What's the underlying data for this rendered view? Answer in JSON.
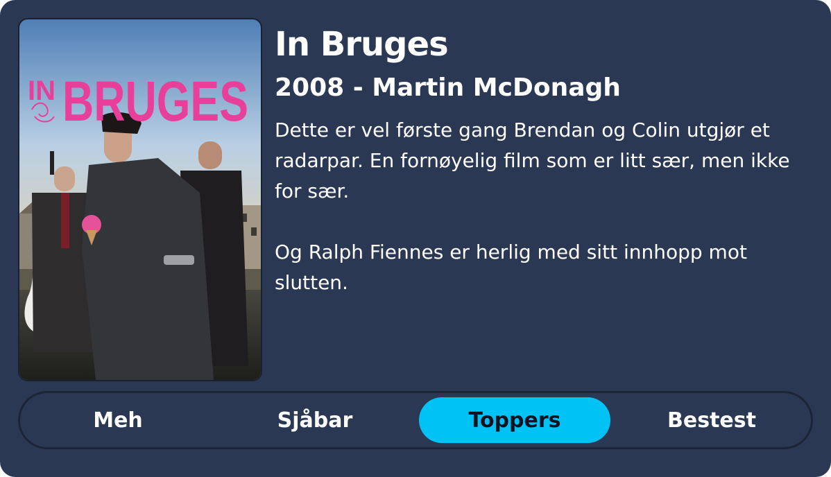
{
  "movie": {
    "title": "In Bruges",
    "subtitle": "2008 - Martin McDonagh",
    "poster_title_small": "IN",
    "poster_title_large": "BRUGES",
    "review_paragraphs": [
      "Dette er vel første gang Brendan og Colin utgjør et radarpar. En fornøyelig film som er litt sær, men ikke for sær.",
      "Og Ralph Fiennes er herlig med sitt innhopp mot slutten."
    ]
  },
  "rating": {
    "options": [
      "Meh",
      "Sjåbar",
      "Toppers",
      "Bestest"
    ],
    "selected_index": 2
  },
  "colors": {
    "background": "#2b3853",
    "accent": "#00c2f5",
    "poster_title": "#e8409a"
  }
}
